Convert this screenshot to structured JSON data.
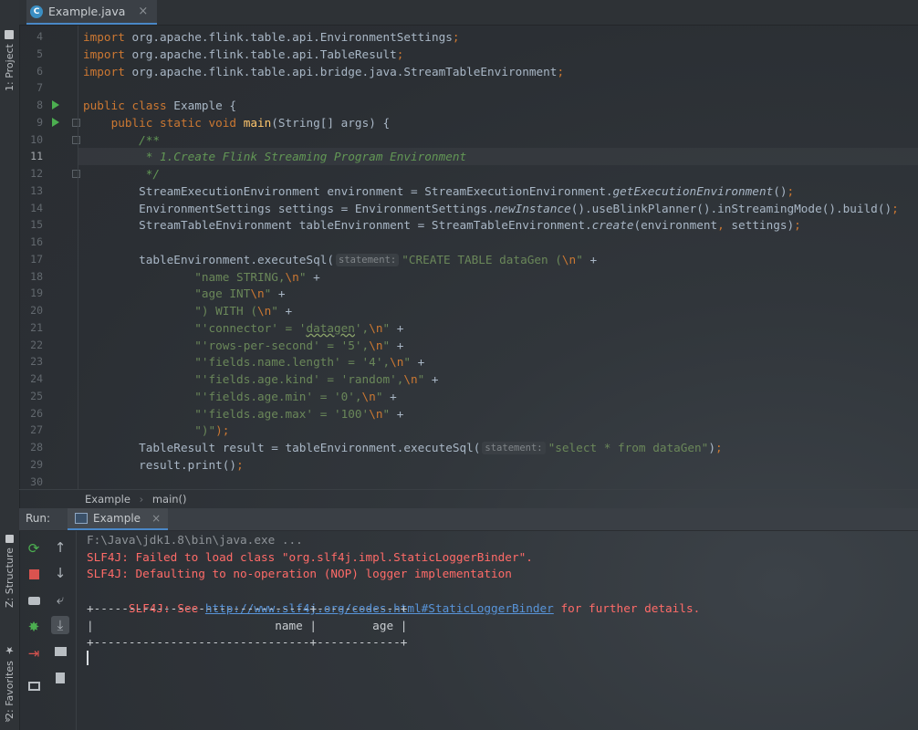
{
  "tab": {
    "icon_letter": "C",
    "title": "Example.java",
    "close": "×"
  },
  "sidebar": {
    "project_label": "1: Project",
    "structure_label": "Z: Structure",
    "favorites_label": "2: Favorites",
    "more": "»"
  },
  "editor": {
    "lines": [
      {
        "n": "4",
        "tokens": [
          {
            "t": "import",
            "c": "kw"
          },
          {
            "t": " org.apache.flink.table.api.EnvironmentSettings"
          },
          {
            "t": ";",
            "c": "kw"
          }
        ]
      },
      {
        "n": "5",
        "tokens": [
          {
            "t": "import",
            "c": "kw"
          },
          {
            "t": " org.apache.flink.table.api.TableResult"
          },
          {
            "t": ";",
            "c": "kw"
          }
        ]
      },
      {
        "n": "6",
        "tokens": [
          {
            "t": "import",
            "c": "kw"
          },
          {
            "t": " org.apache.flink.table.api.bridge.java.StreamTableEnvironment"
          },
          {
            "t": ";",
            "c": "kw"
          }
        ]
      },
      {
        "n": "7",
        "tokens": []
      },
      {
        "n": "8",
        "run": true,
        "tokens": [
          {
            "t": "public class",
            "c": "kw"
          },
          {
            "t": " Example {"
          }
        ]
      },
      {
        "n": "9",
        "run": true,
        "fold": true,
        "tokens": [
          {
            "t": "    "
          },
          {
            "t": "public static void",
            "c": "kw"
          },
          {
            "t": " "
          },
          {
            "t": "main",
            "c": "fn"
          },
          {
            "t": "(String[] args) {"
          }
        ]
      },
      {
        "n": "10",
        "fold": true,
        "tokens": [
          {
            "t": "        "
          },
          {
            "t": "/**",
            "c": "cm"
          }
        ]
      },
      {
        "n": "11",
        "current": true,
        "tokens": [
          {
            "t": "         "
          },
          {
            "t": "* 1.Create Flink Streaming Program Environment",
            "c": "cm"
          }
        ]
      },
      {
        "n": "12",
        "fold": true,
        "tokens": [
          {
            "t": "         "
          },
          {
            "t": "*/",
            "c": "cm"
          }
        ]
      },
      {
        "n": "13",
        "tokens": [
          {
            "t": "        StreamExecutionEnvironment environment = StreamExecutionEnvironment."
          },
          {
            "t": "getExecutionEnvironment",
            "c": "it"
          },
          {
            "t": "()"
          },
          {
            "t": ";",
            "c": "kw"
          }
        ]
      },
      {
        "n": "14",
        "tokens": [
          {
            "t": "        EnvironmentSettings settings = EnvironmentSettings."
          },
          {
            "t": "newInstance",
            "c": "it"
          },
          {
            "t": "().useBlinkPlanner().inStreamingMode().build()"
          },
          {
            "t": ";",
            "c": "kw"
          }
        ]
      },
      {
        "n": "15",
        "tokens": [
          {
            "t": "        StreamTableEnvironment tableEnvironment = StreamTableEnvironment."
          },
          {
            "t": "create",
            "c": "it"
          },
          {
            "t": "(environment"
          },
          {
            "t": ",",
            "c": "kw"
          },
          {
            "t": " settings)"
          },
          {
            "t": ";",
            "c": "kw"
          }
        ]
      },
      {
        "n": "16",
        "tokens": []
      },
      {
        "n": "17",
        "tokens": [
          {
            "t": "        tableEnvironment.executeSql("
          },
          {
            "t": "statement:",
            "c": "hint"
          },
          {
            "t": "\"CREATE TABLE dataGen (",
            "c": "str"
          },
          {
            "t": "\\n",
            "c": "esc"
          },
          {
            "t": "\"",
            "c": "str"
          },
          {
            "t": " +"
          }
        ]
      },
      {
        "n": "18",
        "tokens": [
          {
            "t": "                "
          },
          {
            "t": "\"name STRING,",
            "c": "str"
          },
          {
            "t": "\\n",
            "c": "esc"
          },
          {
            "t": "\"",
            "c": "str"
          },
          {
            "t": " +"
          }
        ]
      },
      {
        "n": "19",
        "tokens": [
          {
            "t": "                "
          },
          {
            "t": "\"age INT",
            "c": "str"
          },
          {
            "t": "\\n",
            "c": "esc"
          },
          {
            "t": "\"",
            "c": "str"
          },
          {
            "t": " +"
          }
        ]
      },
      {
        "n": "20",
        "tokens": [
          {
            "t": "                "
          },
          {
            "t": "\") WITH (",
            "c": "str"
          },
          {
            "t": "\\n",
            "c": "esc"
          },
          {
            "t": "\"",
            "c": "str"
          },
          {
            "t": " +"
          }
        ]
      },
      {
        "n": "21",
        "tokens": [
          {
            "t": "                "
          },
          {
            "t": "\"'connector' = '",
            "c": "str"
          },
          {
            "t": "datagen",
            "c": "str sq"
          },
          {
            "t": "',",
            "c": "str"
          },
          {
            "t": "\\n",
            "c": "esc"
          },
          {
            "t": "\"",
            "c": "str"
          },
          {
            "t": " +"
          }
        ]
      },
      {
        "n": "22",
        "tokens": [
          {
            "t": "                "
          },
          {
            "t": "\"'rows-per-second' = '5',",
            "c": "str"
          },
          {
            "t": "\\n",
            "c": "esc"
          },
          {
            "t": "\"",
            "c": "str"
          },
          {
            "t": " +"
          }
        ]
      },
      {
        "n": "23",
        "tokens": [
          {
            "t": "                "
          },
          {
            "t": "\"'fields.name.length' = '4',",
            "c": "str"
          },
          {
            "t": "\\n",
            "c": "esc"
          },
          {
            "t": "\"",
            "c": "str"
          },
          {
            "t": " +"
          }
        ]
      },
      {
        "n": "24",
        "tokens": [
          {
            "t": "                "
          },
          {
            "t": "\"'fields.age.kind' = 'random',",
            "c": "str"
          },
          {
            "t": "\\n",
            "c": "esc"
          },
          {
            "t": "\"",
            "c": "str"
          },
          {
            "t": " +"
          }
        ]
      },
      {
        "n": "25",
        "tokens": [
          {
            "t": "                "
          },
          {
            "t": "\"'fields.age.min' = '0',",
            "c": "str"
          },
          {
            "t": "\\n",
            "c": "esc"
          },
          {
            "t": "\"",
            "c": "str"
          },
          {
            "t": " +"
          }
        ]
      },
      {
        "n": "26",
        "tokens": [
          {
            "t": "                "
          },
          {
            "t": "\"'fields.age.max' = '100'",
            "c": "str"
          },
          {
            "t": "\\n",
            "c": "esc"
          },
          {
            "t": "\"",
            "c": "str"
          },
          {
            "t": " +"
          }
        ]
      },
      {
        "n": "27",
        "tokens": [
          {
            "t": "                "
          },
          {
            "t": "\")\"",
            "c": "str"
          },
          {
            "t": ");",
            "c": "kw"
          }
        ]
      },
      {
        "n": "28",
        "tokens": [
          {
            "t": "        TableResult result = tableEnvironment.executeSql("
          },
          {
            "t": "statement:",
            "c": "hint"
          },
          {
            "t": "\"select * from dataGen\"",
            "c": "str"
          },
          {
            "t": ")"
          },
          {
            "t": ";",
            "c": "kw"
          }
        ]
      },
      {
        "n": "29",
        "tokens": [
          {
            "t": "        result.print()"
          },
          {
            "t": ";",
            "c": "kw"
          }
        ]
      },
      {
        "n": "30",
        "tokens": []
      }
    ]
  },
  "breadcrumb": {
    "class_name": "Example",
    "separator": "›",
    "method_name": "main()"
  },
  "run_panel": {
    "label": "Run:",
    "tab_title": "Example",
    "tab_close": "×"
  },
  "console": {
    "cmd_line": "F:\\Java\\jdk1.8\\bin\\java.exe ...",
    "error1": "SLF4J: Failed to load class \"org.slf4j.impl.StaticLoggerBinder\".",
    "error2": "SLF4J: Defaulting to no-operation (NOP) logger implementation",
    "error3_prefix": "SLF4J: See ",
    "error3_link": "http://www.slf4j.org/codes.html#StaticLoggerBinder",
    "error3_suffix": " for further details.",
    "table_border": "+-------------------------------+------------+",
    "table_header": "|                          name |        age |",
    "table_border2": "+-------------------------------+------------+"
  },
  "colors": {
    "accent": "#4a88c7",
    "keyword": "#cc7832",
    "string": "#6a8759",
    "comment": "#629755",
    "error": "#ff6b68",
    "link": "#5894d9",
    "run": "#4caf50"
  }
}
